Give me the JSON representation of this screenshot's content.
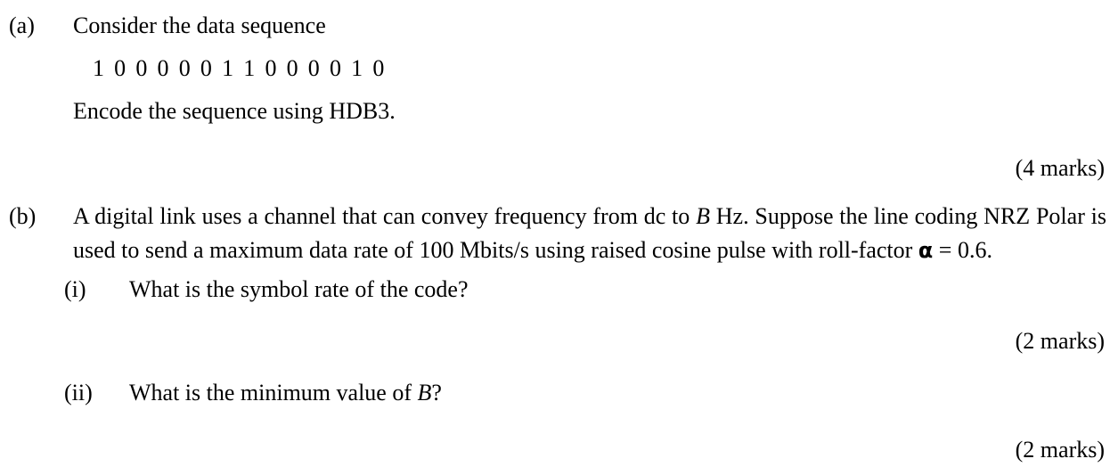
{
  "document": {
    "type": "exam-question",
    "background_color": "#ffffff",
    "text_color": "#000000"
  },
  "questions": [
    {
      "label": "(a)",
      "lines": {
        "intro": "Consider the data sequence",
        "sequence": "1 0 0 0 0 0 1 1 0 0 0 0 1 0",
        "instruction": "Encode the sequence using HDB3."
      },
      "marks": "(4 marks)"
    },
    {
      "label": "(b)",
      "body": {
        "part1": "A digital link uses a channel that can convey frequency from dc to ",
        "var1": "B",
        "part2": " Hz. Suppose the line coding NRZ Polar is used to send a maximum data rate of 100 Mbits/s using raised cosine pulse with roll-factor ",
        "alpha": "α",
        "part3": " = 0.6."
      },
      "subparts": [
        {
          "label": "(i)",
          "text": "What is the symbol rate of the code?",
          "marks": "(2 marks)"
        },
        {
          "label": "(ii)",
          "text_before": "What is the minimum value of ",
          "var": "B",
          "text_after": "?",
          "marks": "(2 marks)"
        }
      ]
    }
  ]
}
